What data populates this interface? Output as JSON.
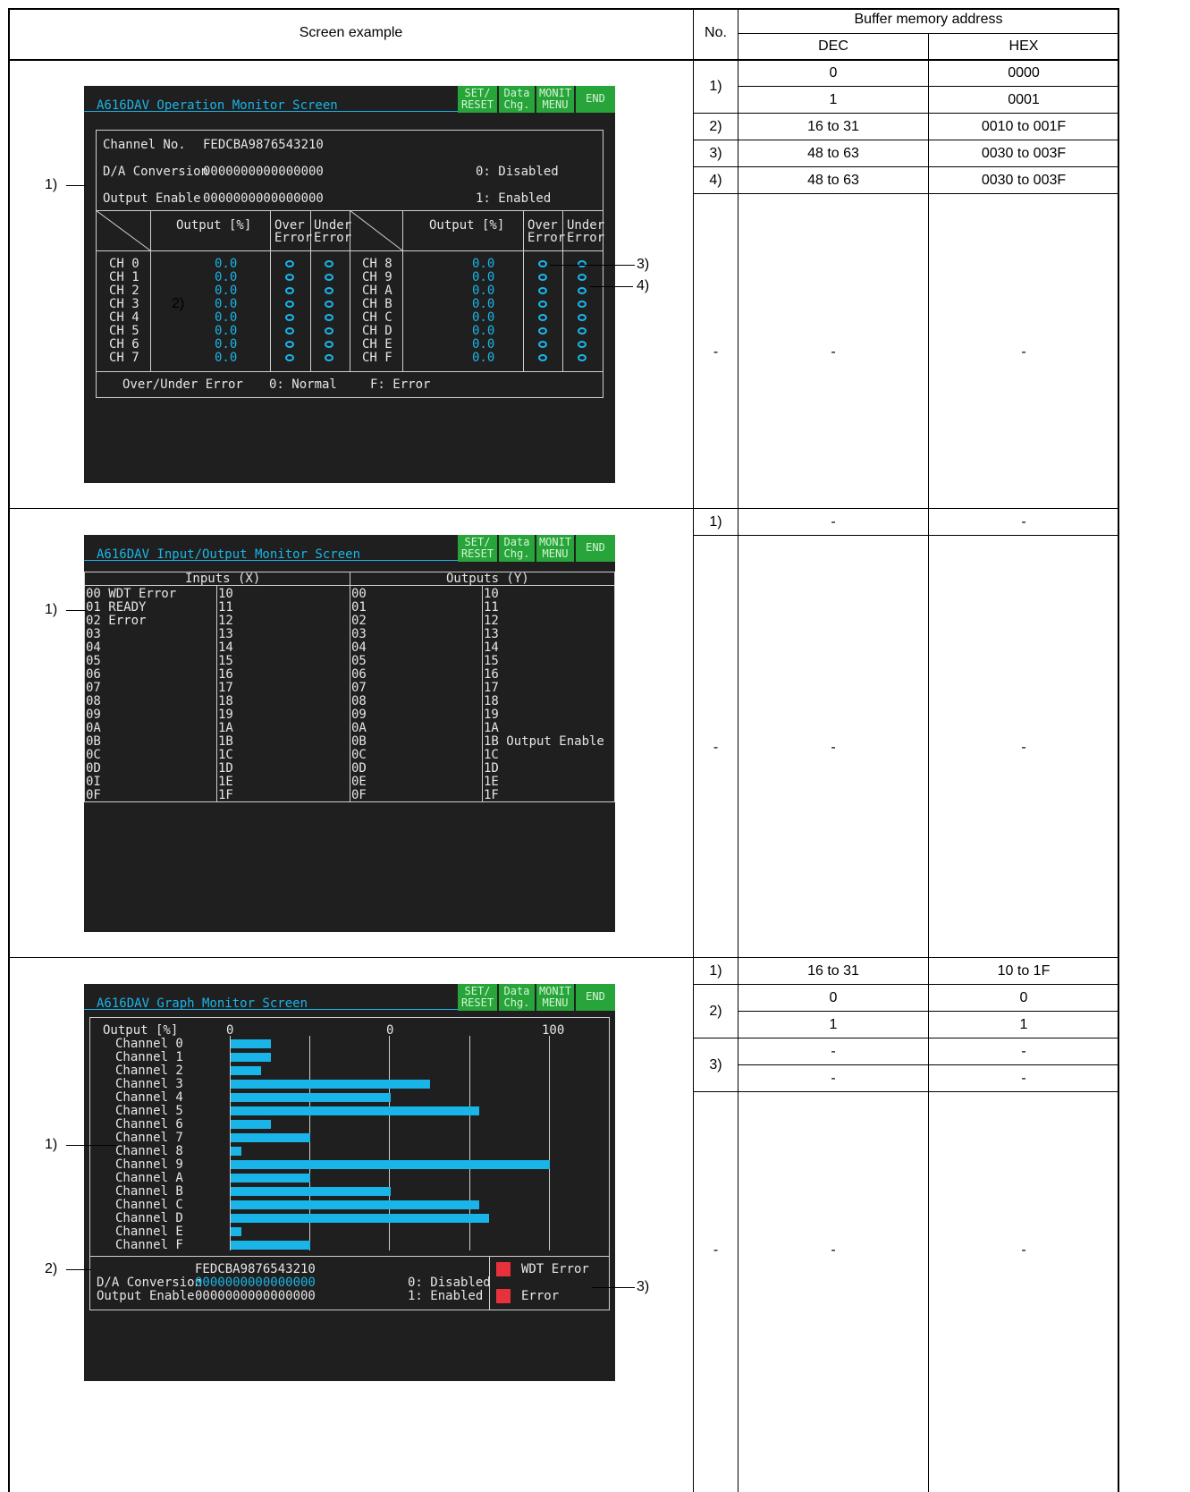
{
  "headers": {
    "screen_example": "Screen example",
    "no": "No.",
    "buffer": "Buffer memory address",
    "dec": "DEC",
    "hex": "HEX"
  },
  "sections": [
    {
      "rows": [
        {
          "no": "1)",
          "dec": [
            "0",
            "1"
          ],
          "hex": [
            "0000",
            "0001"
          ]
        },
        {
          "no": "2)",
          "dec": [
            "16 to 31"
          ],
          "hex": [
            "0010 to 001F"
          ]
        },
        {
          "no": "3)",
          "dec": [
            "48 to 63"
          ],
          "hex": [
            "0030 to 003F"
          ]
        },
        {
          "no": "4)",
          "dec": [
            "48 to 63"
          ],
          "hex": [
            "0030 to 003F"
          ]
        },
        {
          "no": "-",
          "dec": [
            "-"
          ],
          "hex": [
            "-"
          ]
        }
      ],
      "callouts": [
        "1)",
        "2)",
        "3)",
        "4)"
      ]
    },
    {
      "rows": [
        {
          "no": "1)",
          "dec": [
            "-"
          ],
          "hex": [
            "-"
          ]
        },
        {
          "no": "-",
          "dec": [
            "-"
          ],
          "hex": [
            "-"
          ]
        }
      ],
      "callouts": [
        "1)"
      ]
    },
    {
      "rows": [
        {
          "no": "1)",
          "dec": [
            "16 to 31"
          ],
          "hex": [
            "10 to 1F"
          ]
        },
        {
          "no": "2)",
          "dec": [
            "0",
            "1"
          ],
          "hex": [
            "0",
            "1"
          ]
        },
        {
          "no": "3)",
          "dec": [
            "-",
            "-"
          ],
          "hex": [
            "-",
            "-"
          ]
        },
        {
          "no": "-",
          "dec": [
            "-"
          ],
          "hex": [
            "-"
          ]
        }
      ],
      "callouts": [
        "1)",
        "2)",
        "3)"
      ]
    }
  ],
  "buttons": {
    "set_reset": "SET/\nRESET",
    "data_chg": "Data\nChg.",
    "monit_menu": "MONIT\nMENU",
    "end": "END"
  },
  "screen1": {
    "title": "A616DAV Operation Monitor Screen",
    "channel_no_label": "Channel No.",
    "channel_no_value": "FEDCBA9876543210",
    "da_conv_label": "D/A Conversion",
    "da_conv_value": "0000000000000000",
    "output_enable_label": "Output Enable",
    "output_enable_value": "0000000000000000",
    "disabled": "0: Disabled",
    "enabled": "1: Enabled",
    "output_pct": "Output [%]",
    "over_error": "Over\nError",
    "under_error": "Under\nError",
    "channels_left": [
      "CH 0",
      "CH 1",
      "CH 2",
      "CH 3",
      "CH 4",
      "CH 5",
      "CH 6",
      "CH 7"
    ],
    "channels_right": [
      "CH 8",
      "CH 9",
      "CH A",
      "CH B",
      "CH C",
      "CH D",
      "CH E",
      "CH F"
    ],
    "values_left": [
      "0.0",
      "0.0",
      "0.0",
      "0.0",
      "0.0",
      "0.0",
      "0.0",
      "0.0"
    ],
    "values_right": [
      "0.0",
      "0.0",
      "0.0",
      "0.0",
      "0.0",
      "0.0",
      "0.0",
      "0.0"
    ],
    "error_legend": "Over/Under Error",
    "normal": "0: Normal",
    "error": "F: Error"
  },
  "screen2": {
    "title": "A616DAV Input/Output Monitor Screen",
    "inputs_header": "Inputs (X)",
    "outputs_header": "Outputs (Y)",
    "x_col1": [
      "00 WDT Error",
      "01 READY",
      "02 Error",
      "03",
      "04",
      "05",
      "06",
      "07",
      "08",
      "09",
      "0A",
      "0B",
      "0C",
      "0D",
      "0I",
      "0F"
    ],
    "x_col2": [
      "10",
      "11",
      "12",
      "13",
      "14",
      "15",
      "16",
      "17",
      "18",
      "19",
      "1A",
      "1B",
      "1C",
      "1D",
      "1E",
      "1F"
    ],
    "y_col1": [
      "00",
      "01",
      "02",
      "03",
      "04",
      "05",
      "06",
      "07",
      "08",
      "09",
      "0A",
      "0B",
      "0C",
      "0D",
      "0E",
      "0F"
    ],
    "y_col2": [
      "10",
      "11",
      "12",
      "13",
      "14",
      "15",
      "16",
      "17",
      "18",
      "19",
      "1A",
      "1B Output Enable",
      "1C",
      "1D",
      "1E",
      "1F"
    ]
  },
  "screen3": {
    "title": "A616DAV Graph Monitor Screen",
    "output_pct": "Output [%]",
    "axis_ticks": [
      "0",
      "0",
      "100"
    ],
    "channel_labels": [
      "Channel 0",
      "Channel 1",
      "Channel 2",
      "Channel 3",
      "Channel 4",
      "Channel 5",
      "Channel 6",
      "Channel 7",
      "Channel 8",
      "Channel 9",
      "Channel A",
      "Channel B",
      "Channel C",
      "Channel D",
      "Channel E",
      "Channel F"
    ],
    "channel_no_value": "FEDCBA9876543210",
    "da_conv_label": "D/A Conversion",
    "da_conv_value": "0000000000000000",
    "output_enable_label": "Output Enable",
    "output_enable_value": "0000000000000000",
    "disabled": "0: Disabled",
    "enabled": "1: Enabled",
    "wdt_error": "WDT Error",
    "error": "Error"
  },
  "chart_data": {
    "type": "bar",
    "categories": [
      "Channel 0",
      "Channel 1",
      "Channel 2",
      "Channel 3",
      "Channel 4",
      "Channel 5",
      "Channel 6",
      "Channel 7",
      "Channel 8",
      "Channel 9",
      "Channel A",
      "Channel B",
      "Channel C",
      "Channel D",
      "Channel E",
      "Channel F"
    ],
    "values": [
      12.5,
      12.5,
      9.5,
      62.5,
      50,
      78,
      12.5,
      25,
      3.5,
      100,
      25,
      50,
      78,
      81,
      3.5,
      25
    ],
    "xlim": [
      0,
      100
    ],
    "orientation": "horizontal",
    "colors": {
      "bar": "#19b5e8",
      "background": "#1f1f1f"
    }
  },
  "colors": {
    "screen_bg": "#1f1f1f",
    "accent": "#19b5e8",
    "button": "#27a43a",
    "alarm": "#e8323b"
  }
}
